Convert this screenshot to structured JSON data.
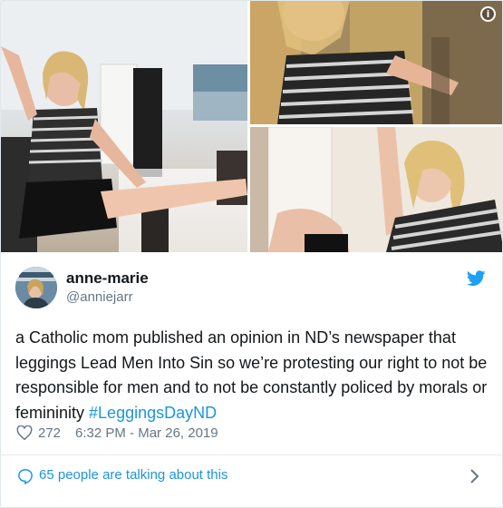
{
  "author": {
    "name": "anne-marie",
    "handle": "@anniejarr"
  },
  "tweet": {
    "text_before": "a Catholic mom published an opinion in ND’s newspaper that leggings Lead Men Into Sin so we’re protesting our right to not be responsible for men and to not be constantly policed by morals or femininity ",
    "hashtag": "#LeggingsDayND"
  },
  "meta": {
    "likes": "272",
    "timestamp": "6:32 PM - Mar 26, 2019"
  },
  "footer": {
    "talking_label": "65 people are talking about this"
  },
  "icons": {
    "info": "info-icon",
    "bird": "twitter-bird-icon",
    "heart": "heart-icon",
    "bubble": "speech-bubble-icon",
    "chevron": "chevron-right-icon"
  },
  "colors": {
    "link": "#1b95e0",
    "secondary_text": "#657786",
    "text": "#14171a"
  }
}
